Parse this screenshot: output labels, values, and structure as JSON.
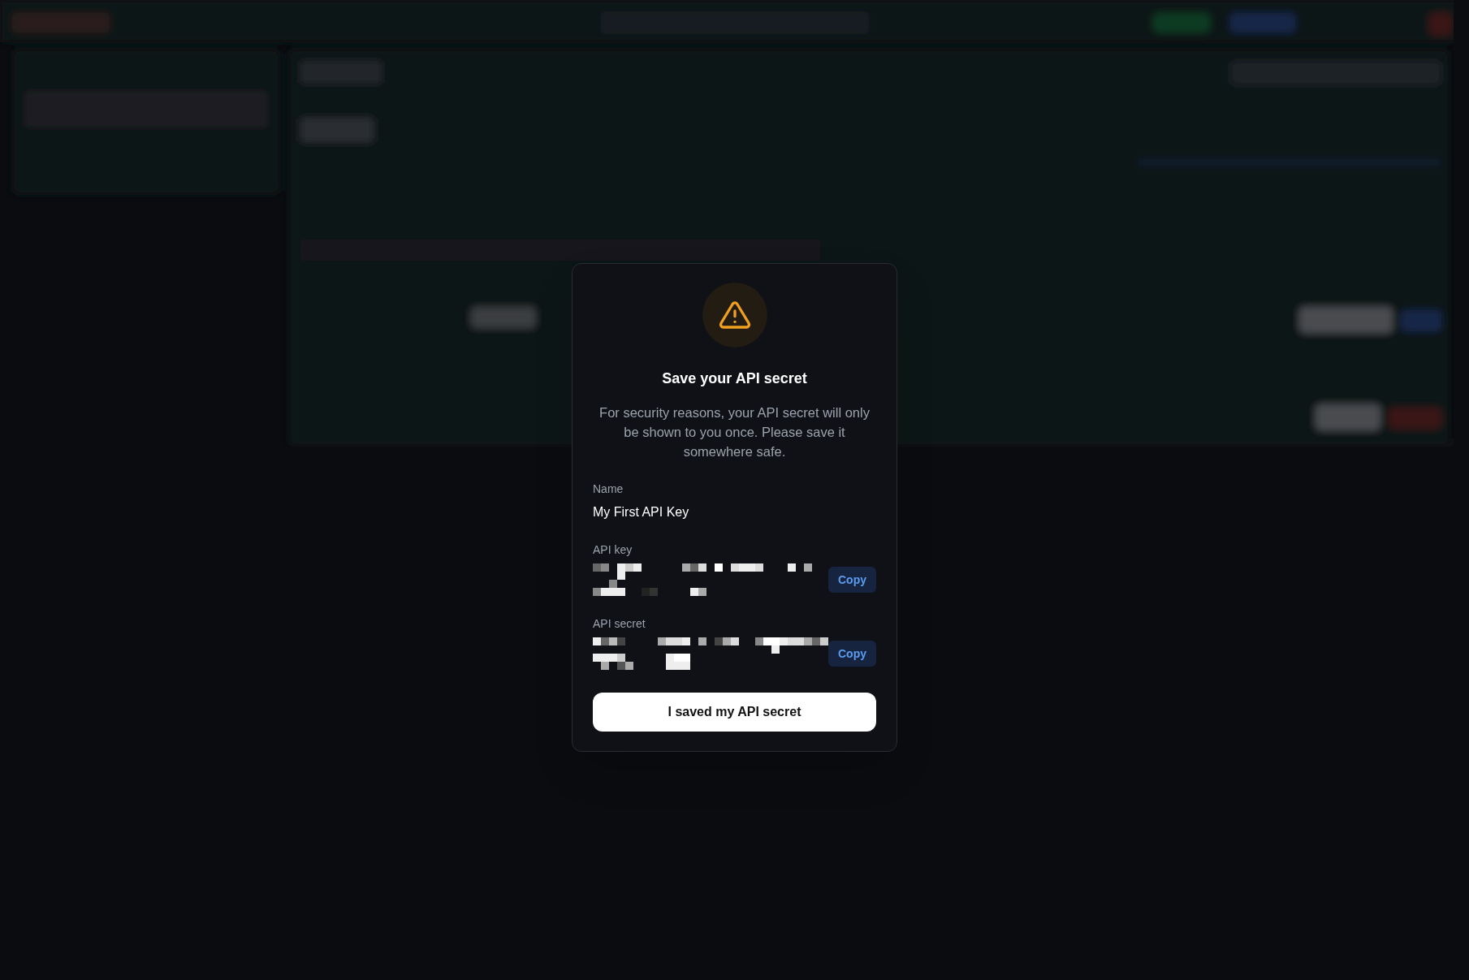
{
  "dialog": {
    "title": "Save your API secret",
    "message": "For security reasons, your API secret will only be shown to you once. Please save it somewhere safe.",
    "fields": [
      {
        "kind": "text",
        "label": "Name",
        "value": "My First API Key"
      },
      {
        "kind": "redacted",
        "label": "API key",
        "copy_button": "Copy"
      },
      {
        "kind": "redacted",
        "label": "API secret",
        "copy_button": "Copy"
      }
    ],
    "confirm_button": "I saved my API secret"
  }
}
